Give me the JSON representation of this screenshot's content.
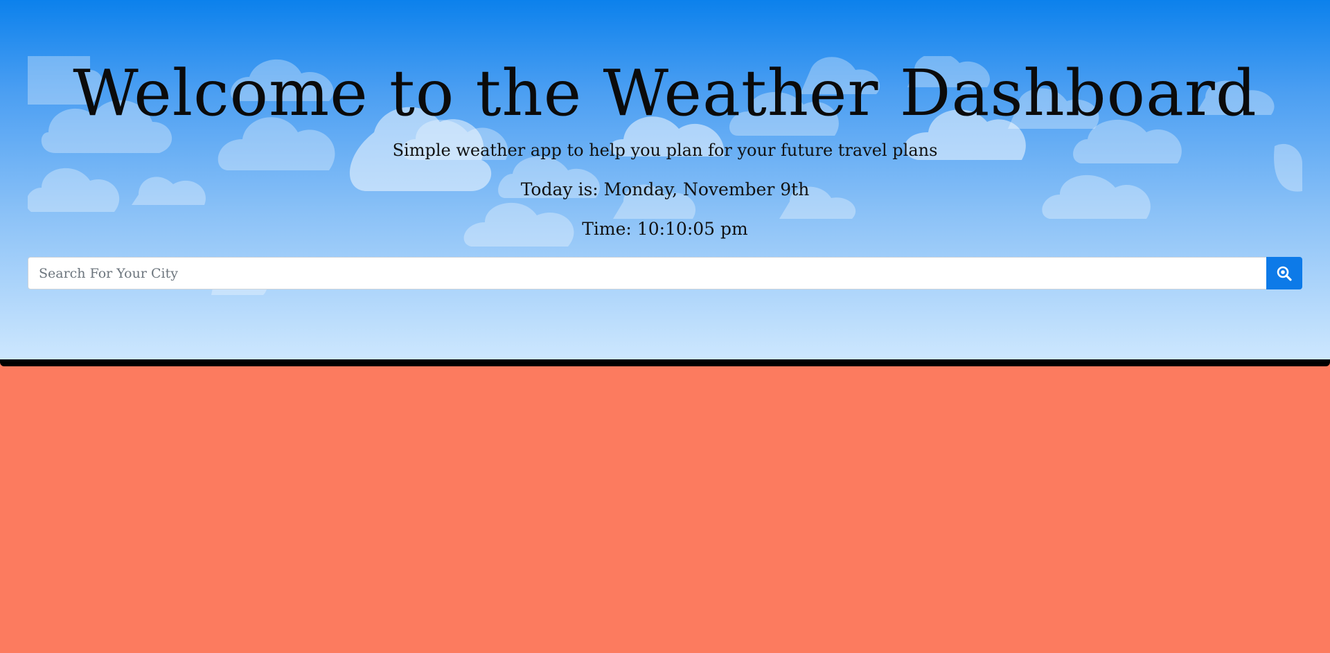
{
  "header": {
    "title": "Welcome to the Weather Dashboard",
    "subtitle": "Simple weather app to help you plan for your future travel plans",
    "today": "Today is: Monday, November 9th",
    "time": "Time: 10:10:05 pm"
  },
  "search": {
    "placeholder": "Search For Your City",
    "value": "",
    "button_icon": "search-icon"
  },
  "colors": {
    "page_background": "#fc7b5f",
    "hero_top": "#0c81ec",
    "hero_bottom": "#cde7fe",
    "search_button": "#0d7ae8"
  }
}
